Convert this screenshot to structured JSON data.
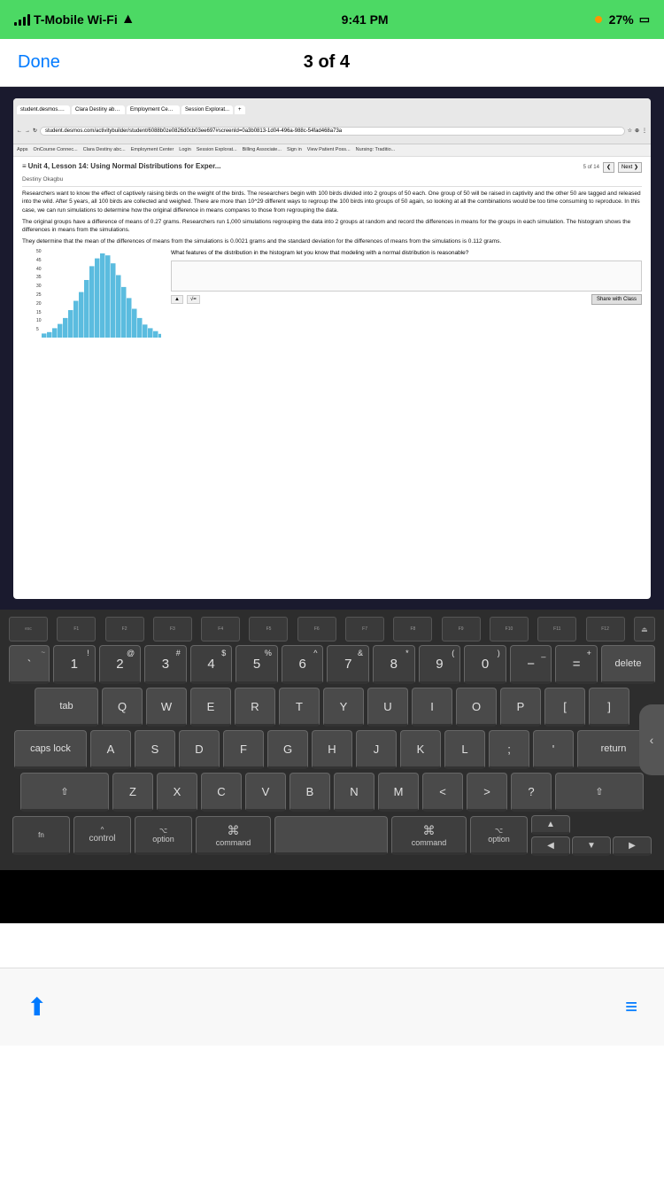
{
  "statusBar": {
    "carrier": "T-Mobile Wi-Fi",
    "time": "9:41 PM",
    "battery": "27%"
  },
  "navBar": {
    "doneLabel": "Done",
    "title": "3 of 4"
  },
  "browser": {
    "tabs": [
      "student.desmos.com/activi...",
      "Clara Destiny abc...",
      "Employment Center",
      "Session Explorat..."
    ],
    "url": "student.desmos.com/activitybuilder/student/6088b0ze08264d0cb03ee697#screenId=0a3b0813-1d04-496a-988c-54fad468a73a",
    "bookmarks": [
      "Apps",
      "OnCourse Connec...",
      "Clara Destiny abc...",
      "Employment Center",
      "Login",
      "Session Explorat...",
      "Billing Associate ...",
      "Sign in",
      "View Patient Poss...",
      "Nursing: Traditio..."
    ]
  },
  "lessonContent": {
    "siteTitle": "Unit 4, Lesson 14: Using Normal Distributions for Exper...",
    "subtitle": "Destiny Okagbu",
    "pagination": "5 of 14",
    "paragraph1": "Researchers want to know the effect of captively raising birds on the weight of the birds. The researchers begin with 100 birds divided into 2 groups of 50 each. One group of 50 will be raised in captivity and the other 50 are tagged and released into the wild. After 5 years, all 100 birds are collected and weighed. There are more than 10^29 different ways to regroup the 100 birds into groups of 50 again, so looking at all the combinations would be too time consuming to reproduce. In this case, we can run simulations to determine how the original difference in means compares to those from regrouping the data.",
    "paragraph2": "The original groups have a difference of means of 0.27 grams. Researchers run 1,000 simulations regrouping the data into 2 groups at random and record the differences in means for the groups in each simulation. The histogram shows the differences in means from the simulations.",
    "paragraph3": "They determine that the mean of the differences of means from the simulations is 0.0021 grams and the standard deviation for the differences of means from the simulations is 0.112 grams.",
    "questionText": "What features of the distribution in the histogram let you know that modeling with a normal distribution is reasonable?",
    "shareBtnLabel": "Share with Class",
    "nextLabel": "Next ❯",
    "prevLabel": "❮ 5 of 14"
  },
  "histogram": {
    "yLabels": [
      "50",
      "45",
      "40",
      "35",
      "30",
      "25",
      "20",
      "15",
      "10",
      "5"
    ],
    "bars": [
      2,
      3,
      5,
      7,
      10,
      14,
      18,
      22,
      28,
      35,
      40,
      43,
      42,
      38,
      32,
      26,
      20,
      14,
      10,
      7,
      5,
      3,
      2
    ]
  },
  "keyboard": {
    "fnKeys": [
      "esc",
      "F1",
      "F2",
      "F3",
      "F4",
      "F5",
      "F6",
      "F7",
      "F8",
      "F9",
      "F10",
      "F11",
      "F12"
    ],
    "row1": [
      "`~",
      "1!",
      "2@",
      "3#",
      "4$",
      "5%",
      "6^",
      "7&",
      "8*",
      "9(",
      "0)",
      "-_",
      "=+"
    ],
    "row2": [
      "Q",
      "W",
      "E",
      "R",
      "T",
      "Y",
      "U",
      "I",
      "O",
      "P",
      "[",
      "]"
    ],
    "row3": [
      "A",
      "S",
      "D",
      "F",
      "G",
      "H",
      "J",
      "K",
      "L",
      ";:",
      "'\""
    ],
    "row4": [
      "Z",
      "X",
      "C",
      "V",
      "B",
      "N",
      "M",
      ",<",
      ".>",
      "?/"
    ],
    "modifiers": [
      "option",
      "command",
      "command",
      "option"
    ]
  },
  "bottomToolbar": {
    "shareIcon": "⬆",
    "listIcon": "≡"
  }
}
